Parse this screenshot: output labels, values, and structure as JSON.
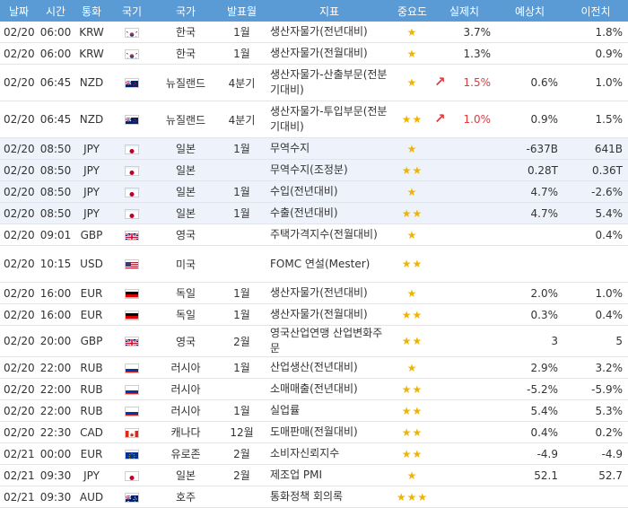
{
  "headers": {
    "date": "날짜",
    "time": "시간",
    "currency": "통화",
    "flag": "국기",
    "country": "국가",
    "period": "발표월",
    "indicator": "지표",
    "importance": "중요도",
    "actual": "실제치",
    "forecast": "예상치",
    "previous": "이전치"
  },
  "colors": {
    "header_bg": "#5b9bd5",
    "star": "#f0b400",
    "up_red": "#e0393e",
    "highlight_row": "#eef3fb"
  },
  "rows": [
    {
      "date": "02/20",
      "time": "06:00",
      "currency": "KRW",
      "flag": "kr-flag-icon",
      "country": "한국",
      "period": "1월",
      "indicator": "생산자물가(전년대비)",
      "stars": "★",
      "arrow": "",
      "actual": "3.7%",
      "forecast": "",
      "previous": "1.8%",
      "red": false
    },
    {
      "date": "02/20",
      "time": "06:00",
      "currency": "KRW",
      "flag": "kr-flag-icon",
      "country": "한국",
      "period": "1월",
      "indicator": "생산자물가(전월대비)",
      "stars": "★",
      "arrow": "",
      "actual": "1.3%",
      "forecast": "",
      "previous": "0.9%",
      "red": false
    },
    {
      "date": "02/20",
      "time": "06:45",
      "currency": "NZD",
      "flag": "nz-flag-icon",
      "country": "뉴질랜드",
      "period": "4분기",
      "indicator": "생산자물가-산출부문(전분기대비)",
      "stars": "★",
      "arrow": "↗",
      "actual": "1.5%",
      "forecast": "0.6%",
      "previous": "1.0%",
      "red": true
    },
    {
      "date": "02/20",
      "time": "06:45",
      "currency": "NZD",
      "flag": "nz-flag-icon",
      "country": "뉴질랜드",
      "period": "4분기",
      "indicator": "생산자물가-투입부문(전분기대비)",
      "stars": "★★",
      "arrow": "↗",
      "actual": "1.0%",
      "forecast": "0.9%",
      "previous": "1.5%",
      "red": true
    },
    {
      "date": "02/20",
      "time": "08:50",
      "currency": "JPY",
      "flag": "jp-flag-icon",
      "country": "일본",
      "period": "1월",
      "indicator": "무역수지",
      "stars": "★",
      "arrow": "",
      "actual": "",
      "forecast": "-637B",
      "previous": "641B",
      "red": false
    },
    {
      "date": "02/20",
      "time": "08:50",
      "currency": "JPY",
      "flag": "jp-flag-icon",
      "country": "일본",
      "period": "",
      "indicator": "무역수지(조정분)",
      "stars": "★★",
      "arrow": "",
      "actual": "",
      "forecast": "0.28T",
      "previous": "0.36T",
      "red": false
    },
    {
      "date": "02/20",
      "time": "08:50",
      "currency": "JPY",
      "flag": "jp-flag-icon",
      "country": "일본",
      "period": "1월",
      "indicator": "수입(전년대비)",
      "stars": "★",
      "arrow": "",
      "actual": "",
      "forecast": "4.7%",
      "previous": "-2.6%",
      "red": false
    },
    {
      "date": "02/20",
      "time": "08:50",
      "currency": "JPY",
      "flag": "jp-flag-icon",
      "country": "일본",
      "period": "1월",
      "indicator": "수출(전년대비)",
      "stars": "★★",
      "arrow": "",
      "actual": "",
      "forecast": "4.7%",
      "previous": "5.4%",
      "red": false
    },
    {
      "date": "02/20",
      "time": "09:01",
      "currency": "GBP",
      "flag": "gb-flag-icon",
      "country": "영국",
      "period": "",
      "indicator": "주택가격지수(전월대비)",
      "stars": "★",
      "arrow": "",
      "actual": "",
      "forecast": "",
      "previous": "0.4%",
      "red": false
    },
    {
      "date": "02/20",
      "time": "10:15",
      "currency": "USD",
      "flag": "us-flag-icon",
      "country": "미국",
      "period": "",
      "indicator": "FOMC 연설(Mester)",
      "stars": "★★",
      "arrow": "",
      "actual": "",
      "forecast": "",
      "previous": "",
      "red": false
    },
    {
      "date": "02/20",
      "time": "16:00",
      "currency": "EUR",
      "flag": "de-flag-icon",
      "country": "독일",
      "period": "1월",
      "indicator": "생산자물가(전년대비)",
      "stars": "★",
      "arrow": "",
      "actual": "",
      "forecast": "2.0%",
      "previous": "1.0%",
      "red": false
    },
    {
      "date": "02/20",
      "time": "16:00",
      "currency": "EUR",
      "flag": "de-flag-icon",
      "country": "독일",
      "period": "1월",
      "indicator": "생산자물가(전월대비)",
      "stars": "★★",
      "arrow": "",
      "actual": "",
      "forecast": "0.3%",
      "previous": "0.4%",
      "red": false
    },
    {
      "date": "02/20",
      "time": "20:00",
      "currency": "GBP",
      "flag": "gb-flag-icon",
      "country": "영국",
      "period": "2월",
      "indicator": "영국산업연맹 산업변화주문",
      "stars": "★★",
      "arrow": "",
      "actual": "",
      "forecast": "3",
      "previous": "5",
      "red": false
    },
    {
      "date": "02/20",
      "time": "22:00",
      "currency": "RUB",
      "flag": "ru-flag-icon",
      "country": "러시아",
      "period": "1월",
      "indicator": "산업생산(전년대비)",
      "stars": "★",
      "arrow": "",
      "actual": "",
      "forecast": "2.9%",
      "previous": "3.2%",
      "red": false
    },
    {
      "date": "02/20",
      "time": "22:00",
      "currency": "RUB",
      "flag": "ru-flag-icon",
      "country": "러시아",
      "period": "",
      "indicator": "소매매출(전년대비)",
      "stars": "★★",
      "arrow": "",
      "actual": "",
      "forecast": "-5.2%",
      "previous": "-5.9%",
      "red": false
    },
    {
      "date": "02/20",
      "time": "22:00",
      "currency": "RUB",
      "flag": "ru-flag-icon",
      "country": "러시아",
      "period": "1월",
      "indicator": "실업률",
      "stars": "★★",
      "arrow": "",
      "actual": "",
      "forecast": "5.4%",
      "previous": "5.3%",
      "red": false
    },
    {
      "date": "02/20",
      "time": "22:30",
      "currency": "CAD",
      "flag": "ca-flag-icon",
      "country": "캐나다",
      "period": "12월",
      "indicator": "도매판매(전월대비)",
      "stars": "★★",
      "arrow": "",
      "actual": "",
      "forecast": "0.4%",
      "previous": "0.2%",
      "red": false
    },
    {
      "date": "02/21",
      "time": "00:00",
      "currency": "EUR",
      "flag": "eu-flag-icon",
      "country": "유로존",
      "period": "2월",
      "indicator": "소비자신뢰지수",
      "stars": "★★",
      "arrow": "",
      "actual": "",
      "forecast": "-4.9",
      "previous": "-4.9",
      "red": false
    },
    {
      "date": "02/21",
      "time": "09:30",
      "currency": "JPY",
      "flag": "jp-flag-icon",
      "country": "일본",
      "period": "2월",
      "indicator": "제조업 PMI",
      "stars": "★",
      "arrow": "",
      "actual": "",
      "forecast": "52.1",
      "previous": "52.7",
      "red": false
    },
    {
      "date": "02/21",
      "time": "09:30",
      "currency": "AUD",
      "flag": "au-flag-icon",
      "country": "호주",
      "period": "",
      "indicator": "통화정책 회의록",
      "stars": "★★★",
      "arrow": "",
      "actual": "",
      "forecast": "",
      "previous": "",
      "red": false
    }
  ]
}
